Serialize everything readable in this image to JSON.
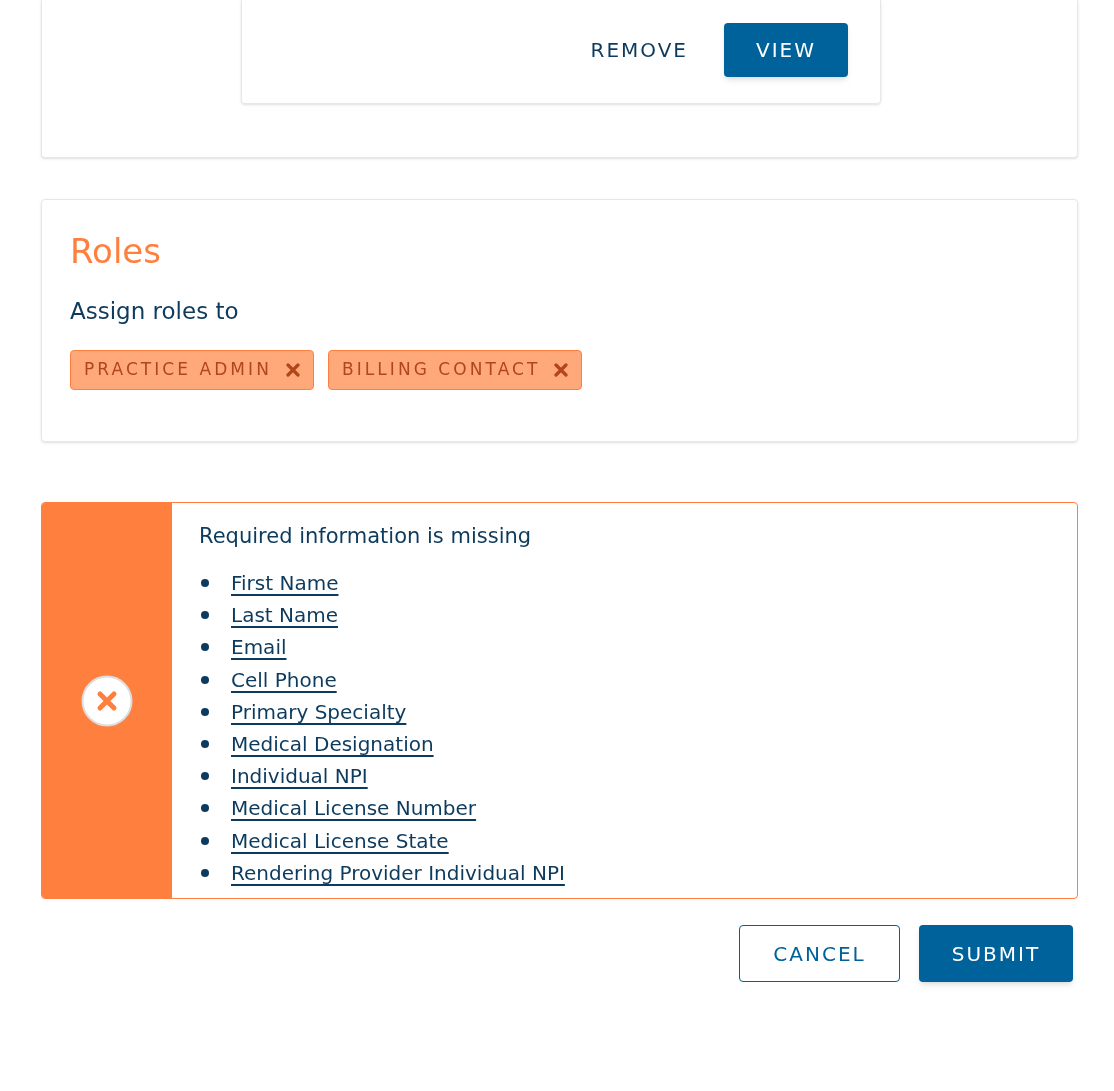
{
  "card_actions": {
    "remove": "REMOVE",
    "view": "VIEW"
  },
  "roles": {
    "title": "Roles",
    "subtitle": "Assign roles to",
    "tags": [
      {
        "label": "PRACTICE ADMIN"
      },
      {
        "label": "BILLING CONTACT"
      }
    ]
  },
  "error": {
    "heading": "Required information is missing",
    "links": [
      "First Name",
      "Last Name",
      "Email",
      "Cell Phone",
      "Primary Specialty",
      "Medical Designation",
      "Individual NPI",
      "Medical License Number",
      "Medical License State",
      "Rendering Provider Individual NPI"
    ]
  },
  "buttons": {
    "cancel": "CANCEL",
    "submit": "SUBMIT"
  }
}
